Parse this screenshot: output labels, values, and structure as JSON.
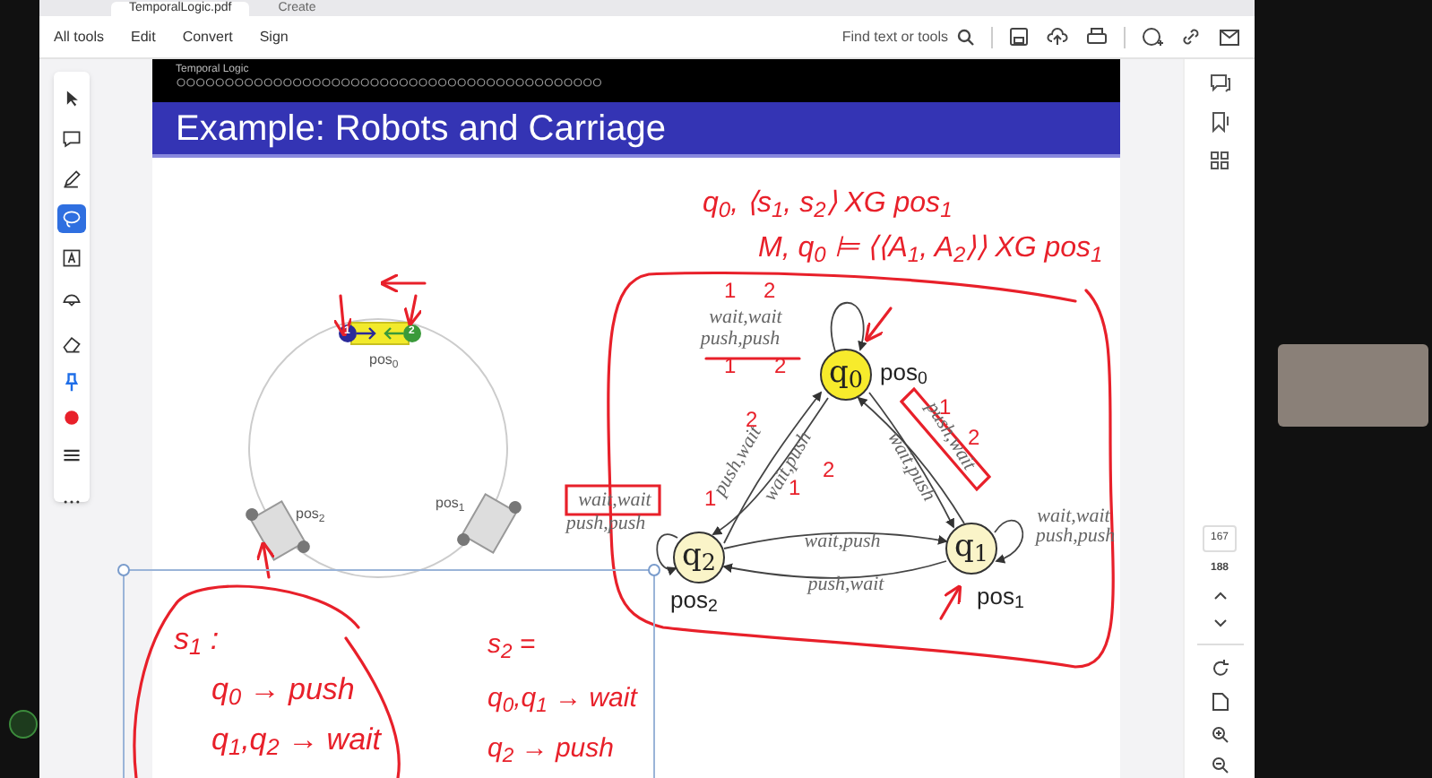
{
  "tabs": [
    {
      "label": "TemporalLogic.pdf",
      "selected": true
    },
    {
      "label": "Create",
      "selected": false
    }
  ],
  "menu": [
    "All tools",
    "Edit",
    "Convert",
    "Sign"
  ],
  "search": {
    "placeholder": "Find text or tools"
  },
  "tools": [
    {
      "selected": false
    },
    {
      "selected": false
    },
    {
      "selected": false
    },
    {
      "selected": true
    },
    {
      "selected": false
    },
    {
      "selected": false
    },
    {
      "selected": false
    },
    {
      "selected": false
    },
    {
      "selected": false
    },
    {
      "selected": false
    },
    {
      "selected": false
    }
  ],
  "slide": {
    "section": "Temporal Logic",
    "title": "Example: Robots and Carriage"
  },
  "track": {
    "carriage_ends": [
      "1",
      "2"
    ],
    "positions": [
      "pos$_{0}$",
      "pos$_{1}$",
      "pos$_{2}$"
    ]
  },
  "graph": {
    "states": [
      {
        "label": "q$_{0}$",
        "position": "pos$_{0}$",
        "highlighted": true
      },
      {
        "label": "q$_{2}$",
        "position": "pos$_{2}$",
        "highlighted": false
      },
      {
        "label": "q$_{1}$",
        "position": "pos$_{1}$",
        "highlighted": false
      }
    ],
    "edge_labels": [
      "wait,wait",
      "push,push",
      "push,wait",
      "wait,push",
      "wait,push",
      "push,wait",
      "wait,wait",
      "push,push",
      "wait,wait",
      "push,push",
      "wait,push",
      "push,wait"
    ]
  },
  "annotations": {
    "formulas": [
      "q$_{0}$, ⟨s$_{1}$, s$_{2}$⟩ XG pos$_{1}$",
      "M, q$_{0}$ ⊨ ⟨⟨A$_{1}$, A$_{2}$⟩⟩ XG pos$_{1}$"
    ],
    "strategy_1": [
      "s$_{1}$ :",
      "q$_{0}$ → push",
      "q$_{1}$,q$_{2}$ → wait"
    ],
    "strategy_2": [
      "s$_{2}$ =",
      "q$_{0}$,q$_{1}$ → wait",
      "q$_{2}$ → push"
    ],
    "marks": [
      "1",
      "2",
      "1",
      "2",
      "1",
      "2",
      "2",
      "1",
      "1",
      "2"
    ]
  },
  "page": {
    "current": "167",
    "total": "188"
  }
}
